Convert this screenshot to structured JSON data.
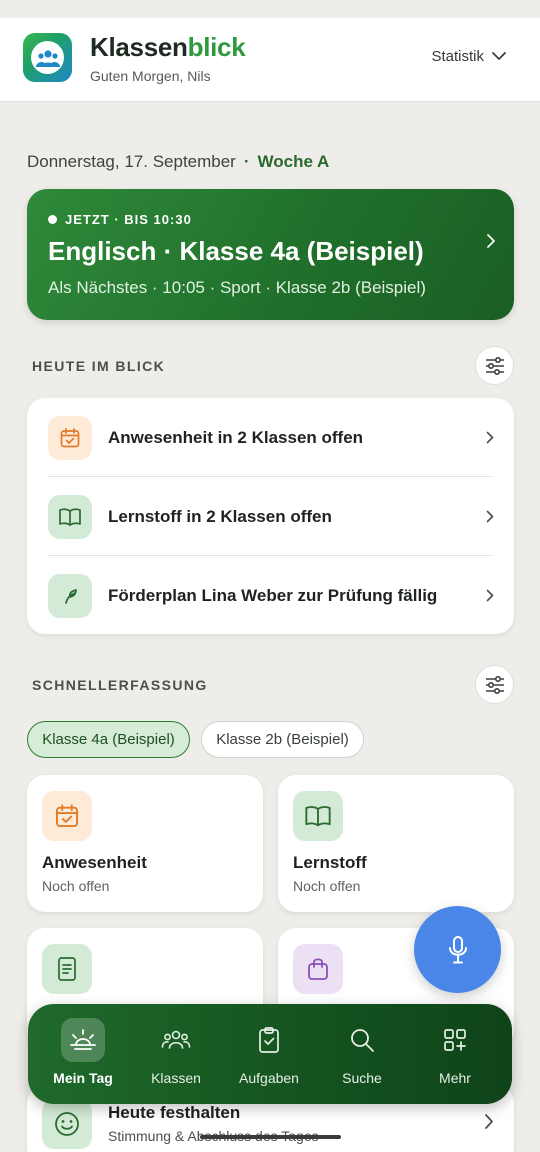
{
  "header": {
    "brand_part1": "Klassen",
    "brand_part2": "blick",
    "greeting": "Guten Morgen, Nils",
    "statistik_label": "Statistik",
    "brand_color": "#2f9a3d"
  },
  "date_bar": {
    "date": "Donnerstag, 17. September",
    "separator": "·",
    "week": "Woche A"
  },
  "now_card": {
    "label": "JETZT · BIS 10:30",
    "title": "Englisch · Klasse 4a (Beispiel)",
    "next": "Als Nächstes · 10:05 · Sport · Klasse 2b (Beispiel)",
    "color": "#236f2d"
  },
  "today": {
    "section_title": "HEUTE IM BLICK",
    "items": [
      {
        "label": "Anwesenheit in 2 Klassen offen",
        "icon": "calendar-check-icon"
      },
      {
        "label": "Lernstoff in 2 Klassen offen",
        "icon": "book-icon"
      },
      {
        "label": "Förderplan Lina Weber zur Prüfung fällig",
        "icon": "sprout-icon"
      }
    ]
  },
  "quick": {
    "section_title": "SCHNELLERFASSUNG",
    "chips": [
      "Klasse 4a (Beispiel)",
      "Klasse 2b (Beispiel)"
    ],
    "selected_chip": "Klasse 4a (Beispiel)",
    "tiles": [
      {
        "title": "Anwesenheit",
        "status": "Noch offen",
        "icon": "calendar-check-icon"
      },
      {
        "title": "Lernstoff",
        "status": "Noch offen",
        "icon": "book-icon"
      },
      {
        "icon": "document-icon"
      },
      {
        "icon": "bag-icon"
      }
    ]
  },
  "reflect": {
    "title": "Heute festhalten",
    "subtitle": "Stimmung & Abschluss des Tages",
    "icon": "smiley-icon"
  },
  "fab": {
    "icon": "microphone-icon",
    "color": "#4a86e8"
  },
  "nav": {
    "items": [
      {
        "label": "Mein Tag",
        "icon": "sunrise-icon"
      },
      {
        "label": "Klassen",
        "icon": "people-icon"
      },
      {
        "label": "Aufgaben",
        "icon": "clipboard-check-icon"
      },
      {
        "label": "Suche",
        "icon": "search-icon"
      },
      {
        "label": "Mehr",
        "icon": "grid-plus-icon"
      }
    ],
    "active": "Mein Tag"
  }
}
